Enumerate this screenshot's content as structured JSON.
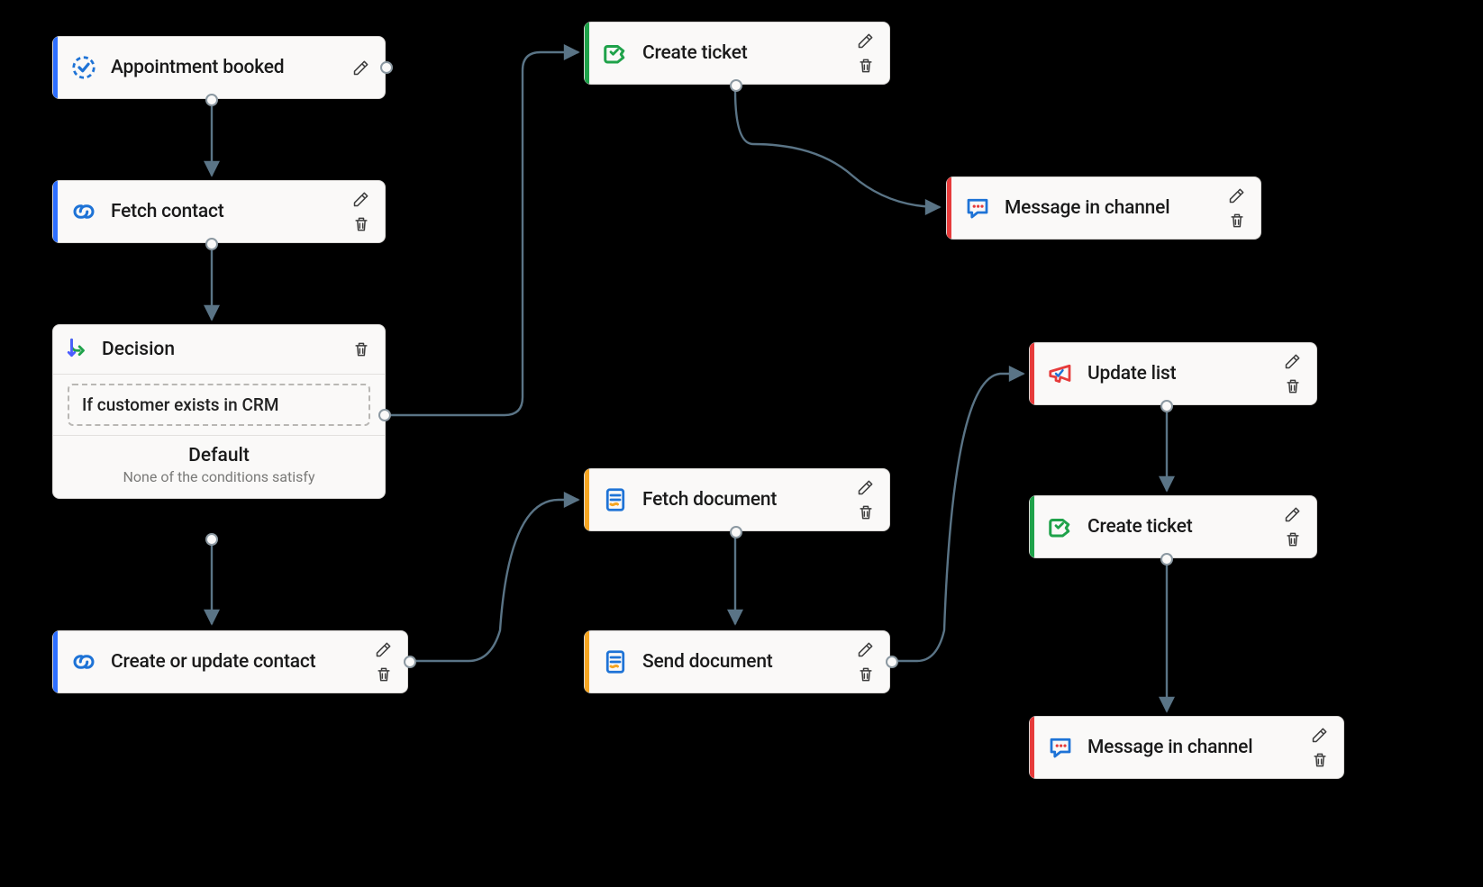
{
  "nodes": {
    "appointment": {
      "label": "Appointment booked"
    },
    "fetchContact": {
      "label": "Fetch contact"
    },
    "decision": {
      "label": "Decision",
      "condition": "If customer exists in CRM",
      "defaultTitle": "Default",
      "defaultSub": "None of the conditions satisfy"
    },
    "createContact": {
      "label": "Create or update contact"
    },
    "createTicket1": {
      "label": "Create ticket"
    },
    "message1": {
      "label": "Message in channel"
    },
    "fetchDoc": {
      "label": "Fetch document"
    },
    "sendDoc": {
      "label": "Send document"
    },
    "updateList": {
      "label": "Update list"
    },
    "createTicket2": {
      "label": "Create ticket"
    },
    "message2": {
      "label": "Message in channel"
    }
  },
  "colors": {
    "blue": "#2e6fff",
    "green": "#1fa24a",
    "red": "#e63b3b",
    "orange": "#f5a623",
    "arrow": "#5a7486",
    "port": "#8b98a1"
  }
}
